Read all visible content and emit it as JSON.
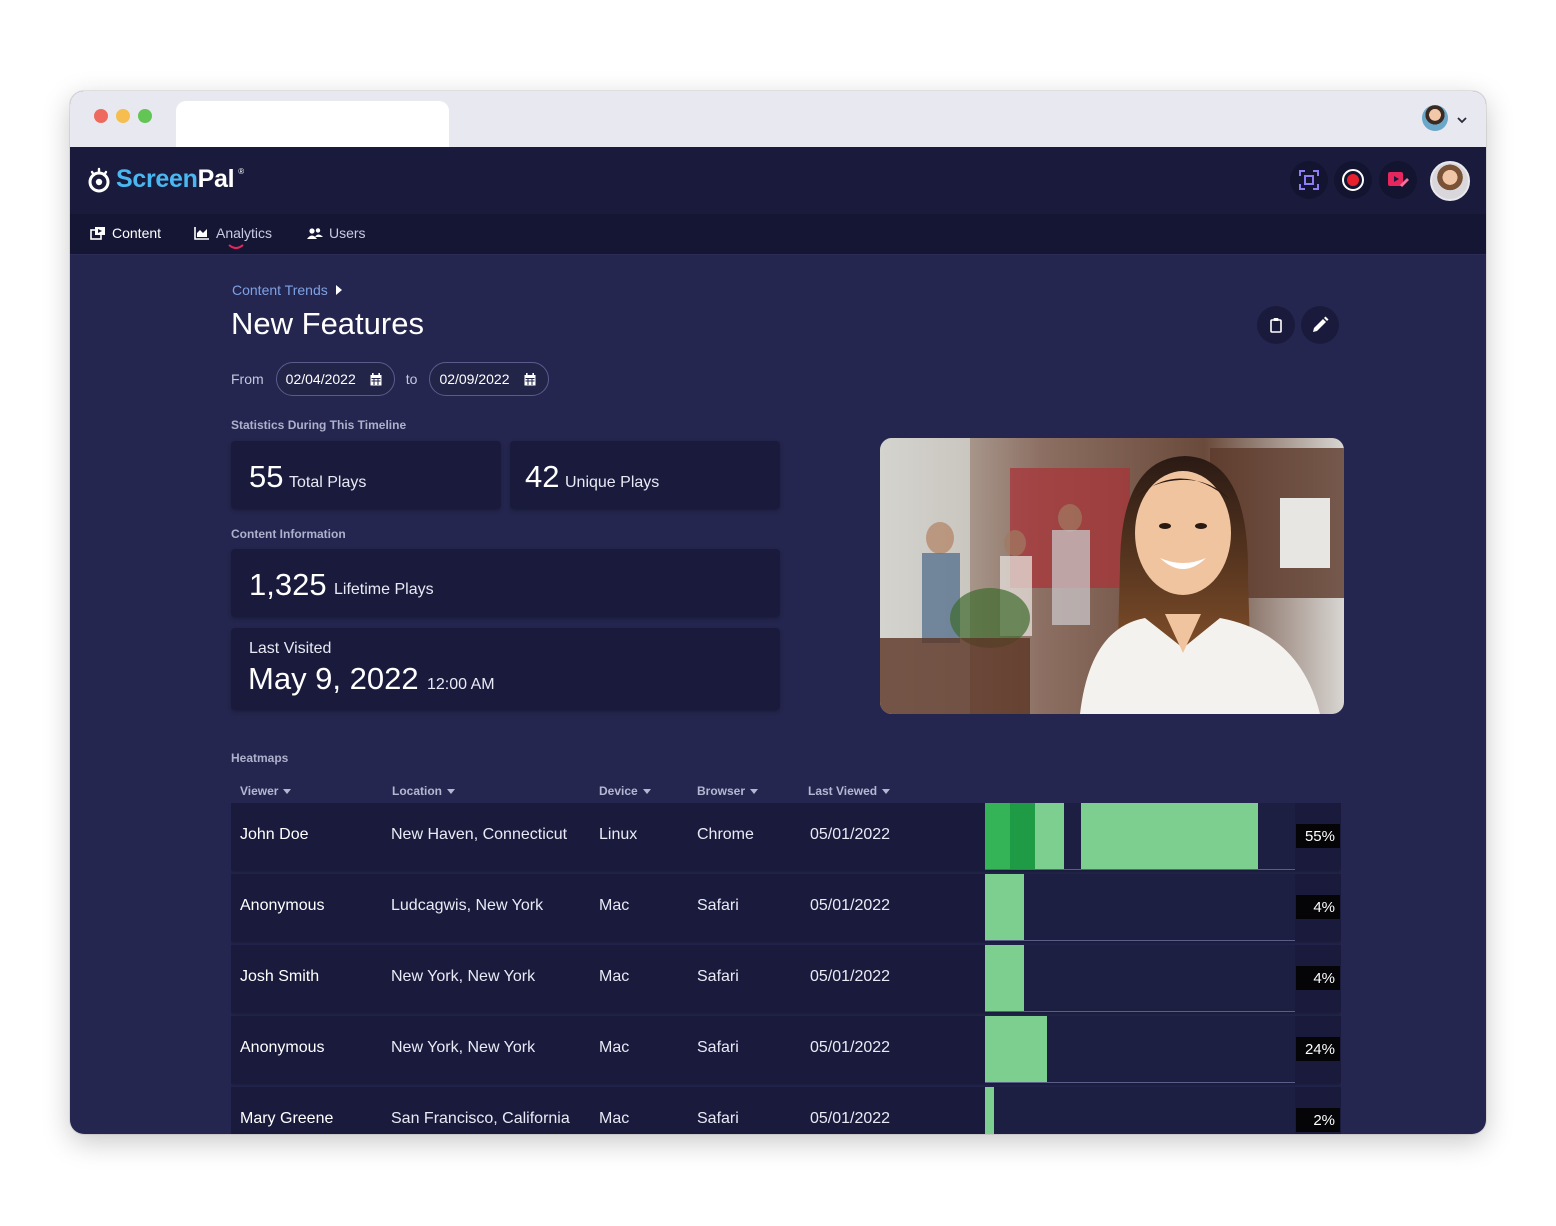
{
  "browser": {
    "avatar": "user-avatar",
    "menu_icon": "chevron-down-icon"
  },
  "app": {
    "logo_screen": "Screen",
    "logo_pal": "Pal",
    "logo_reg": "®"
  },
  "header_actions": [
    "screenshot-icon",
    "record-icon",
    "video-editor-icon"
  ],
  "nav": [
    {
      "label": "Content",
      "icon": "content-icon"
    },
    {
      "label": "Analytics",
      "icon": "chart-icon",
      "active": true
    },
    {
      "label": "Users",
      "icon": "users-icon"
    }
  ],
  "breadcrumb": "Content Trends",
  "page_title": "New Features",
  "date_range": {
    "from_label": "From",
    "from": "02/04/2022",
    "to_label": "to",
    "to": "02/09/2022"
  },
  "statistics": {
    "section_label": "Statistics During This Timeline",
    "total_plays": "55",
    "total_plays_label": "Total Plays",
    "unique_plays": "42",
    "unique_plays_label": "Unique Plays"
  },
  "content_info": {
    "section_label": "Content Information",
    "lifetime_plays": "1,325",
    "lifetime_plays_label": "Lifetime Plays",
    "last_visited_label": "Last Visited",
    "last_visited_date": "May 9, 2022",
    "last_visited_time": "12:00 AM"
  },
  "heatmaps": {
    "section_label": "Heatmaps",
    "columns": [
      "Viewer",
      "Location",
      "Device",
      "Browser",
      "Last Viewed"
    ],
    "colors": {
      "dark": "#1f9b46",
      "mid": "#35b457",
      "light": "#7ccf8f"
    },
    "rows": [
      {
        "viewer": "John Doe",
        "location": "New Haven, Connecticut",
        "device": "Linux",
        "browser": "Chrome",
        "last_viewed": "05/01/2022",
        "percent": "55%",
        "segments": [
          {
            "start": 0,
            "end": 0.08,
            "shade": "mid"
          },
          {
            "start": 0.08,
            "end": 0.16,
            "shade": "dark"
          },
          {
            "start": 0.16,
            "end": 0.255,
            "shade": "light"
          },
          {
            "start": 0.31,
            "end": 0.88,
            "shade": "light"
          }
        ]
      },
      {
        "viewer": "Anonymous",
        "location": "Ludcagwis, New York",
        "device": "Mac",
        "browser": "Safari",
        "last_viewed": "05/01/2022",
        "percent": "4%",
        "segments": [
          {
            "start": 0,
            "end": 0.125,
            "shade": "light"
          }
        ]
      },
      {
        "viewer": "Josh Smith",
        "location": "New York, New York",
        "device": "Mac",
        "browser": "Safari",
        "last_viewed": "05/01/2022",
        "percent": "4%",
        "segments": [
          {
            "start": 0,
            "end": 0.125,
            "shade": "light"
          }
        ]
      },
      {
        "viewer": "Anonymous",
        "location": "New York, New York",
        "device": "Mac",
        "browser": "Safari",
        "last_viewed": "05/01/2022",
        "percent": "24%",
        "segments": [
          {
            "start": 0,
            "end": 0.2,
            "shade": "light"
          }
        ]
      },
      {
        "viewer": "Mary Greene",
        "location": "San Francisco, California",
        "device": "Mac",
        "browser": "Safari",
        "last_viewed": "05/01/2022",
        "percent": "2%",
        "segments": [
          {
            "start": 0,
            "end": 0.03,
            "shade": "light"
          }
        ]
      }
    ]
  }
}
